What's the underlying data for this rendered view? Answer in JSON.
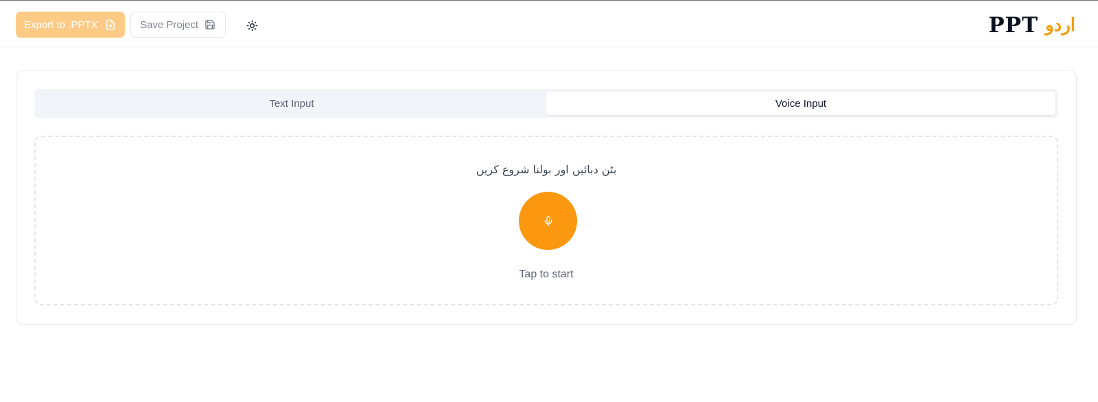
{
  "header": {
    "export_label": "Export to .PPTX",
    "save_label": "Save Project",
    "brand_ppt": "PPT",
    "brand_urdu": "اردو"
  },
  "icons": {
    "export": "file-download-icon",
    "save": "floppy-disk-icon",
    "theme": "sun-icon",
    "mic": "microphone-icon"
  },
  "tabs": [
    {
      "label": "Text Input",
      "active": false
    },
    {
      "label": "Voice Input",
      "active": true
    }
  ],
  "voice": {
    "instruction": "بٹن دبائیں اور بولنا شروع کریں",
    "hint": "Tap to start"
  },
  "colors": {
    "accent": "#fb980f",
    "export_bg": "#fdcb86",
    "brand_urdu": "#f59e0b"
  }
}
